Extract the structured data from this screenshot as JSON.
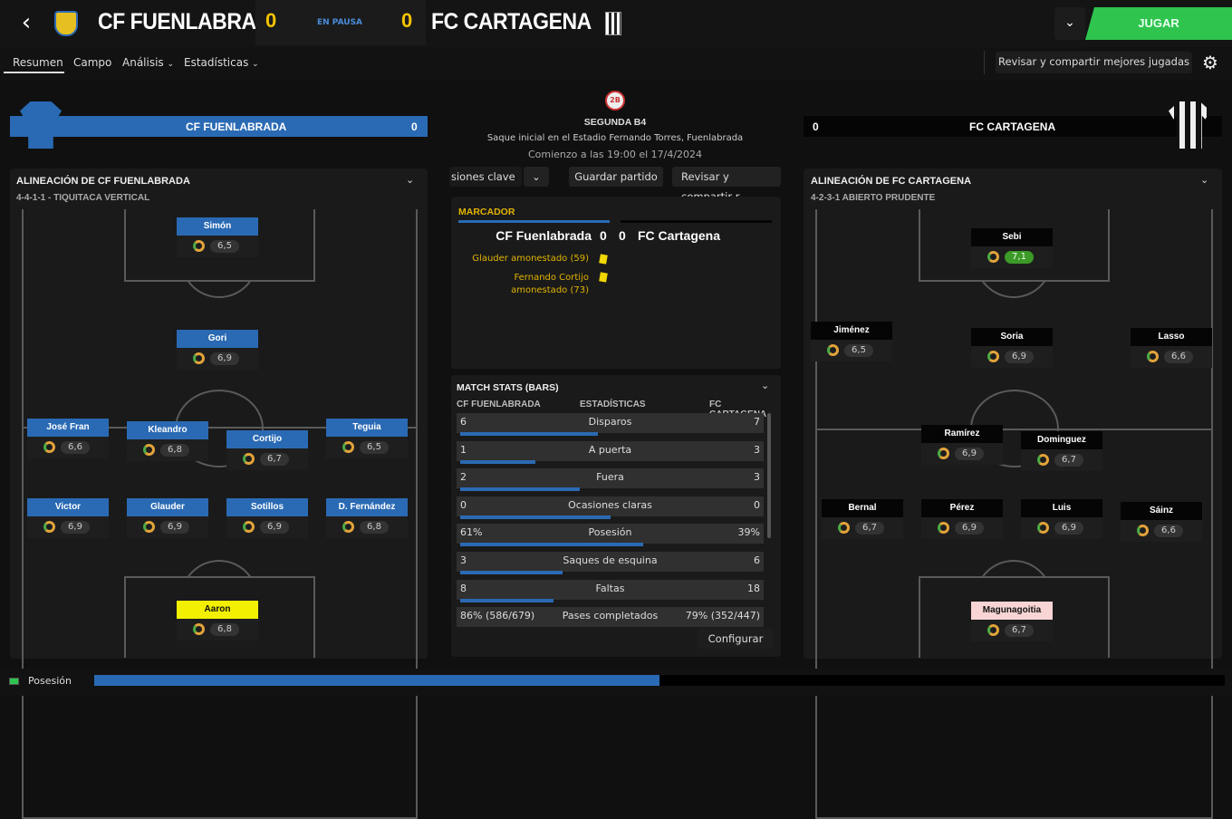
{
  "header": {
    "home_team": "CF FUENLABRADA",
    "away_team": "FC CARTAGENA",
    "home_score": "0",
    "away_score": "0",
    "status": "EN PAUSA",
    "play_label": "JUGAR",
    "back_icon": "back-arrow-icon",
    "dropdown_icon": "chevron-down-icon"
  },
  "tabs": [
    {
      "label": "Resumen",
      "active": true
    },
    {
      "label": "Campo"
    },
    {
      "label": "Análisis"
    },
    {
      "label": "Estadísticas"
    }
  ],
  "share_best_label": "Revisar y compartir mejores jugadas",
  "match_info": {
    "competition": "SEGUNDA B4",
    "kickoff": "Saque inicial en el Estadio Fernando Torres, Fuenlabrada",
    "start_time": "Comienzo a las 19:00 el 17/4/2024",
    "toolbar": [
      "siones clave",
      "Guardar partido",
      "Revisar y compartir r"
    ]
  },
  "home_bar": {
    "name": "CF FUENLABRADA",
    "value": "0"
  },
  "away_bar": {
    "name": "FC CARTAGENA",
    "value": "0"
  },
  "home_lineup": {
    "title": "ALINEACIÓN DE CF FUENLABRADA",
    "formation": "4-4-1-1 - TIQUITACA VERTICAL",
    "players": [
      {
        "name": "Simón",
        "rating": "6,5"
      },
      {
        "name": "Gori",
        "rating": "6,9"
      },
      {
        "name": "José Fran",
        "rating": "6,6"
      },
      {
        "name": "Kleandro",
        "rating": "6,8"
      },
      {
        "name": "Cortijo",
        "rating": "6,7"
      },
      {
        "name": "Teguia",
        "rating": "6,5"
      },
      {
        "name": "Victor",
        "rating": "6,9"
      },
      {
        "name": "Glauder",
        "rating": "6,9"
      },
      {
        "name": "Sotillos",
        "rating": "6,9"
      },
      {
        "name": "D. Fernández",
        "rating": "6,8"
      },
      {
        "name": "Aaron",
        "rating": "6,8"
      }
    ]
  },
  "away_lineup": {
    "title": "ALINEACIÓN DE FC CARTAGENA",
    "formation": "4-2-3-1 ABIERTO PRUDENTE",
    "players": [
      {
        "name": "Sebi",
        "rating": "7,1"
      },
      {
        "name": "Jiménez",
        "rating": "6,5"
      },
      {
        "name": "Soria",
        "rating": "6,9"
      },
      {
        "name": "Lasso",
        "rating": "6,6"
      },
      {
        "name": "Ramírez",
        "rating": "6,9"
      },
      {
        "name": "Dominguez",
        "rating": "6,7"
      },
      {
        "name": "Bernal",
        "rating": "6,7"
      },
      {
        "name": "Pérez",
        "rating": "6,9"
      },
      {
        "name": "Luis",
        "rating": "6,9"
      },
      {
        "name": "Sáinz",
        "rating": "6,6"
      },
      {
        "name": "Magunagoitia",
        "rating": "6,7"
      }
    ]
  },
  "scoreboard": {
    "title": "MARCADOR",
    "home": "CF Fuenlabrada",
    "home_score": "0",
    "away_score": "0",
    "away": "FC Cartagena",
    "events": [
      "Glauder amonestado (59)",
      "Fernando Cortijo",
      "amonestado (73)"
    ]
  },
  "stats": {
    "title": "MATCH STATS (BARS)",
    "col_home": "CF FUENLABRADA",
    "col_mid": "ESTADÍSTICAS",
    "col_away": "FC CARTAGENA",
    "rows": [
      {
        "label": "Disparos",
        "home": "6",
        "away": "7",
        "home_frac": 0.46
      },
      {
        "label": "A puerta",
        "home": "1",
        "away": "3",
        "home_frac": 0.25
      },
      {
        "label": "Fuera",
        "home": "2",
        "away": "3",
        "home_frac": 0.4
      },
      {
        "label": "Ocasiones claras",
        "home": "0",
        "away": "0",
        "home_frac": 0.5
      },
      {
        "label": "Posesión",
        "home": "61%",
        "away": "39%",
        "home_frac": 0.61
      },
      {
        "label": "Saques de esquina",
        "home": "3",
        "away": "6",
        "home_frac": 0.34
      },
      {
        "label": "Faltas",
        "home": "8",
        "away": "18",
        "home_frac": 0.31
      },
      {
        "label": "Pases completados",
        "home": "86% (586/679)",
        "away": "79% (352/447)",
        "home_frac": 0.52
      }
    ],
    "configure_label": "Configurar"
  },
  "possession_footer": {
    "label": "Posesión",
    "home_frac": 0.5
  },
  "colors": {
    "home": "#2a6ab4",
    "away": "#050505",
    "accent_green": "#2ec44e",
    "score_yellow": "#f2c400"
  }
}
